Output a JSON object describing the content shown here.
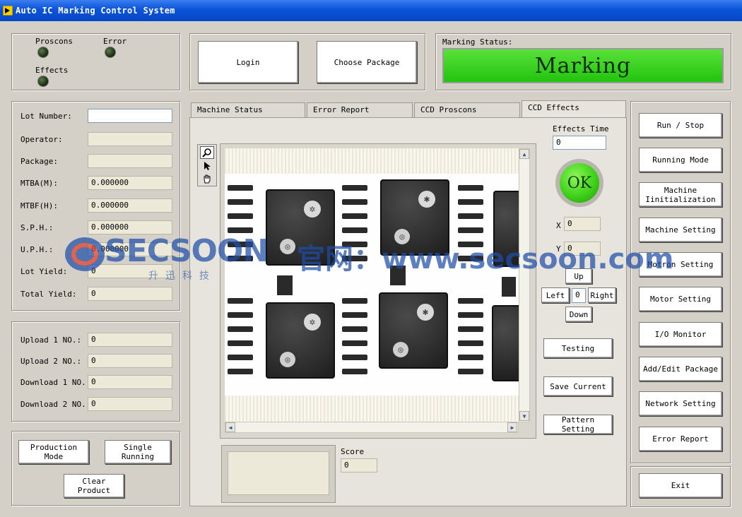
{
  "window": {
    "title": "Auto IC Marking Control System"
  },
  "indicators": {
    "proscons": "Proscons",
    "error": "Error",
    "effects": "Effects"
  },
  "top_buttons": {
    "login": "Login",
    "choose_package": "Choose Package"
  },
  "marking_status": {
    "label": "Marking Status:",
    "value": "Marking",
    "color": "#22c40e"
  },
  "lot_info": {
    "lot_number": {
      "label": "Lot Number:",
      "value": ""
    },
    "operator": {
      "label": "Operator:",
      "value": ""
    },
    "package": {
      "label": "Package:",
      "value": ""
    },
    "mtba": {
      "label": "MTBA(M):",
      "value": "0.000000"
    },
    "mtbf": {
      "label": "MTBF(H):",
      "value": "0.000000"
    },
    "sph": {
      "label": "S.P.H.:",
      "value": "0.000000"
    },
    "uph": {
      "label": "U.P.H.:",
      "value": "0.000000"
    },
    "lot_yield": {
      "label": "Lot Yield:",
      "value": "0"
    },
    "total_yield": {
      "label": "Total Yield:",
      "value": "0"
    }
  },
  "counters": {
    "upload1": {
      "label": "Upload 1 NO.:",
      "value": "0"
    },
    "upload2": {
      "label": "Upload 2 NO.:",
      "value": "0"
    },
    "download1": {
      "label": "Download 1 NO.:",
      "value": "0"
    },
    "download2": {
      "label": "Download 2 NO.:",
      "value": "0"
    }
  },
  "mode_buttons": {
    "production_mode": "Production Mode",
    "single_running": "Single Running",
    "clear_product": "Clear Product"
  },
  "tabs": [
    "Machine Status",
    "Error Report",
    "CCD Proscons",
    "CCD Effects"
  ],
  "ccd": {
    "effects_time_label": "Effects Time",
    "effects_time_value": "0",
    "ok_label": "OK",
    "ok_color": "#3fd11a",
    "x_label": "X",
    "x_value": "0",
    "y_label": "Y",
    "y_value": "0",
    "up": "Up",
    "left": "Left",
    "step_value": "0",
    "right": "Right",
    "down": "Down",
    "testing": "Testing",
    "save_current": "Save Current",
    "pattern_setting": "Pattern Setting",
    "score_label": "Score",
    "score_value": "0"
  },
  "right_buttons": {
    "run_stop": "Run / Stop",
    "running_mode": "Running Mode",
    "machine_init": "Machine Iinitialization",
    "machine_setting": "Machine Setting",
    "motron_setting": "Motron Setting",
    "motor_setting": "Motor Setting",
    "io_monitor": "I/O Monitor",
    "add_edit_package": "Add/Edit Package",
    "network_setting": "Network Setting",
    "error_report": "Error Report",
    "exit": "Exit"
  },
  "watermark": {
    "brand": "SECSOON",
    "cn_brand": "升迅科技",
    "site": "官网：www.secsoon.com"
  },
  "icons": [
    "app-icon",
    "zoom-icon",
    "pointer-icon",
    "hand-icon",
    "scroll-up-icon",
    "scroll-down-icon",
    "scroll-left-icon",
    "scroll-right-icon"
  ]
}
